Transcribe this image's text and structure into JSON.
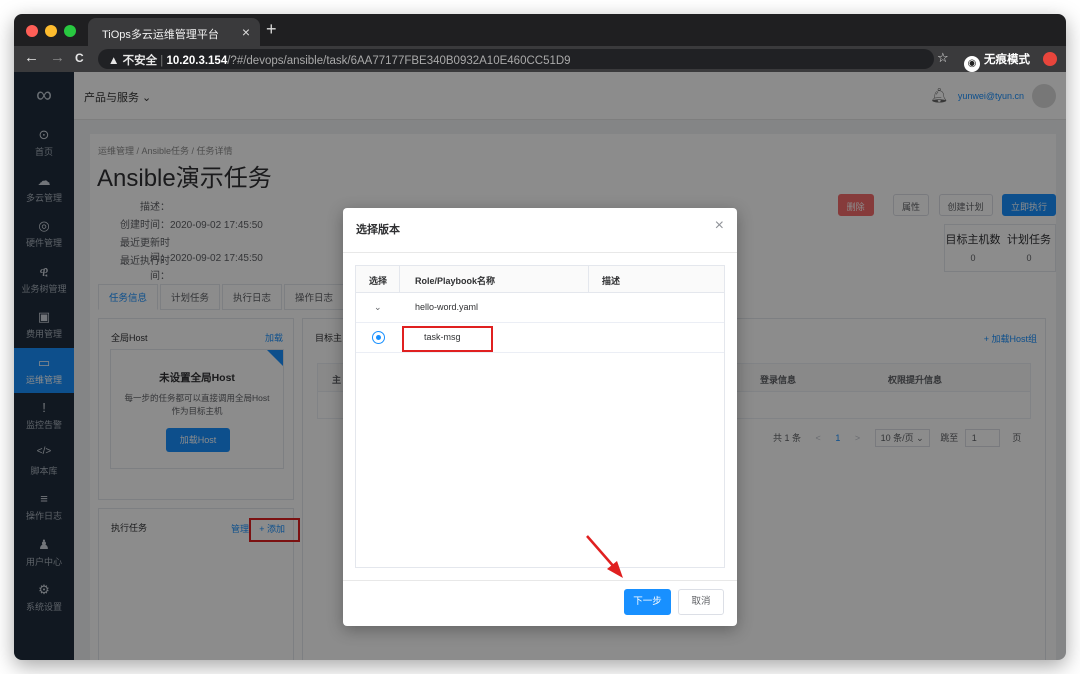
{
  "browser": {
    "tab_title": "TiOps多云运维管理平台",
    "tab_close": "×",
    "new_tab": "+",
    "back": "←",
    "forward": "→",
    "reload": "C",
    "security_label": "▲ 不安全",
    "url_host": "10.20.3.154",
    "url_path": "/?#/devops/ansible/task/6AA77177FBE340B0932A10E460CC51D9",
    "incognito_label": "无痕模式"
  },
  "header": {
    "product_menu": "产品与服务 ⌄",
    "user_email": "yunwei@tyun.cn"
  },
  "sidebar": {
    "items": [
      {
        "label": "首页",
        "icon": "⊙"
      },
      {
        "label": "多云管理",
        "icon": "☁"
      },
      {
        "label": "硬件管理",
        "icon": "◎"
      },
      {
        "label": "业务树管理",
        "icon": "ዊ"
      },
      {
        "label": "费用管理",
        "icon": "▣"
      },
      {
        "label": "运维管理",
        "icon": "▭"
      },
      {
        "label": "监控告警",
        "icon": "!"
      },
      {
        "label": "脚本库",
        "icon": "</>"
      },
      {
        "label": "操作日志",
        "icon": "≡"
      },
      {
        "label": "用户中心",
        "icon": "♟"
      },
      {
        "label": "系统设置",
        "icon": "⚙"
      }
    ]
  },
  "page": {
    "breadcrumb": "运维管理  /  Ansible任务  /  任务详情",
    "title": "Ansible演示任务",
    "desc_label": "描述：",
    "desc_value": "",
    "created_label": "创建时间：",
    "created_value": "2020-09-02 17:45:50",
    "updated_label": "最近更新时间：",
    "updated_value": "2020-09-02 17:45:50",
    "last_exec_label": "最近执行时间：",
    "last_exec_value": "",
    "buttons": {
      "delete": "删除",
      "properties": "属性",
      "create_plan": "创建计划",
      "exec_now": "立即执行"
    },
    "stats": {
      "hosts_label": "目标主机数",
      "hosts_value": "0",
      "plans_label": "计划任务",
      "plans_value": "0"
    },
    "tabs": [
      "任务信息",
      "计划任务",
      "执行日志",
      "操作日志"
    ]
  },
  "left_panel": {
    "title": "全局Host",
    "load_link": "加载",
    "card_title": "未设置全局Host",
    "card_desc": "每一步的任务都可以直接调用全局Host作为目标主机",
    "card_btn": "加载Host",
    "exec_title": "执行任务",
    "manage_link": "管理",
    "add_link": "+ 添加"
  },
  "right_panel": {
    "title": "目标主",
    "add_host_group": "+ 加载Host组",
    "col_host": "主",
    "col_login": "登录信息",
    "col_priv": "权限提升信息",
    "total": "共 1 条",
    "prev": "<",
    "page": "1",
    "next": ">",
    "page_size": "10 条/页 ⌄",
    "goto_label": "跳至",
    "goto_value": "1",
    "page_unit": "页"
  },
  "modal": {
    "title": "选择版本",
    "close": "×",
    "columns": [
      "选择",
      "Role/Playbook名称",
      "描述"
    ],
    "group_row": {
      "toggle": "⌄",
      "name": "hello-word.yaml"
    },
    "selected_row": {
      "name": "task-msg"
    },
    "next_button": "下一步",
    "cancel_button": "取消"
  }
}
